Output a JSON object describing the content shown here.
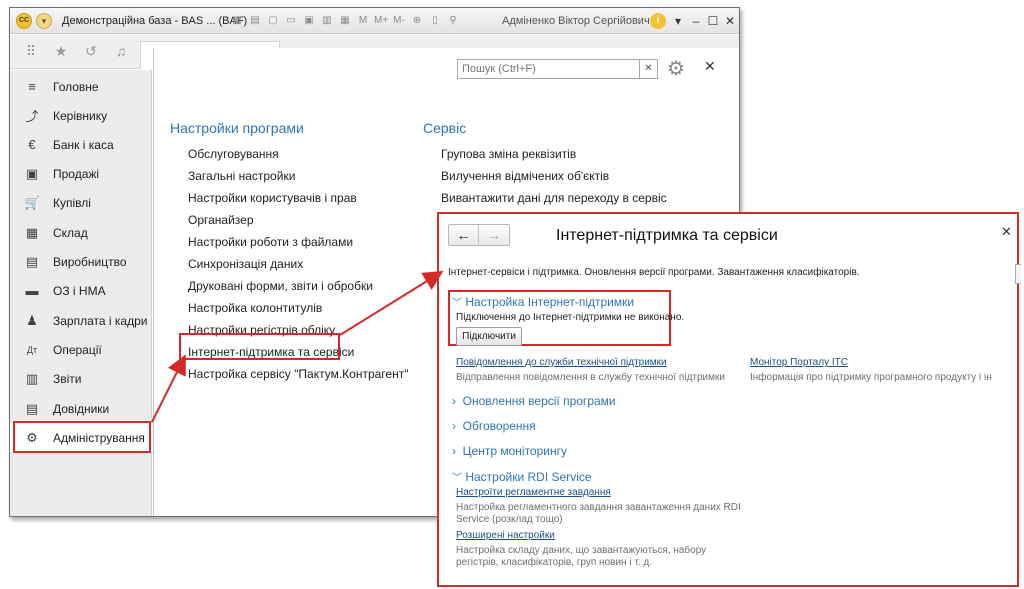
{
  "window": {
    "logo_text": "CC",
    "title": "Демонстраційна база - BAS ...  (BAF)",
    "user": "Адміненко Віктор Сергійович",
    "info_icon": "info-icon",
    "toolbar_labels": [
      "M",
      "M+",
      "M-"
    ]
  },
  "sidebar": {
    "items": [
      {
        "label": "Головне",
        "icon": "≡"
      },
      {
        "label": "Керівнику",
        "icon": "⤴"
      },
      {
        "label": "Банк і каса",
        "icon": "€"
      },
      {
        "label": "Продажі",
        "icon": "▣"
      },
      {
        "label": "Купівлі",
        "icon": "🛒"
      },
      {
        "label": "Склад",
        "icon": "▦"
      },
      {
        "label": "Виробництво",
        "icon": "▤"
      },
      {
        "label": "ОЗ і НМА",
        "icon": "▬"
      },
      {
        "label": "Зарплата і кадри",
        "icon": "♟"
      },
      {
        "label": "Операції",
        "icon": "Дт"
      },
      {
        "label": "Звіти",
        "icon": "▥"
      },
      {
        "label": "Довідники",
        "icon": "▤"
      },
      {
        "label": "Адміністрування",
        "icon": "⚙"
      }
    ]
  },
  "content": {
    "search_placeholder": "Пошук (Ctrl+F)",
    "left_section": {
      "title": "Настройки програми",
      "links": [
        "Обслуговування",
        "Загальні настройки",
        "Настройки користувачів і прав",
        "Органайзер",
        "Настройки роботи з файлами",
        "Синхронізація даних",
        "Друковані форми, звіти і обробки",
        "Настройка колонтитулів",
        "Настройки регістрів обліку",
        "Інтернет-підтримка та сервіси",
        "Настройка сервісу \"Пактум.Контрагент\""
      ]
    },
    "right_section": {
      "title": "Сервіс",
      "links": [
        "Групова зміна реквізитів",
        "Вилучення відмічених об'єктів",
        "Вивантажити дані для переходу в сервіс"
      ]
    }
  },
  "popup": {
    "title": "Інтернет-підтримка та сервіси",
    "description": "Інтернет-сервіси і підтримка. Оновлення версії програми. Завантаження класифікаторів.",
    "support_section": {
      "title": "Настройка Інтернет-підтримки",
      "status": "Підключення до Інтернет-підтримки не виконано.",
      "button": "Підключити"
    },
    "links_row": [
      {
        "link": "Повідомлення до служби технічної підтримки",
        "desc": "Відправлення повідомлення в службу технічної підтримки"
      },
      {
        "link": "Монітор Порталу ІТС",
        "desc": "Інформація про підтримку програмного продукту і ін"
      }
    ],
    "collapsed_sections": [
      "Оновлення версії програми",
      "Обговорення",
      "Центр моніторингу"
    ],
    "rdi": {
      "title": "Настройки RDI Service",
      "items": [
        {
          "link": "Настроїти регламентне завдання",
          "desc1": "Настройка регламентного завдання завантаження даних RDI",
          "desc2": "Service (розклад тощо)"
        },
        {
          "link": "Розширені настройки",
          "desc1": "Настройка складу даних, що завантажуються, набору",
          "desc2": "регістрів, класифікаторів, груп новин і т. д."
        }
      ]
    }
  }
}
